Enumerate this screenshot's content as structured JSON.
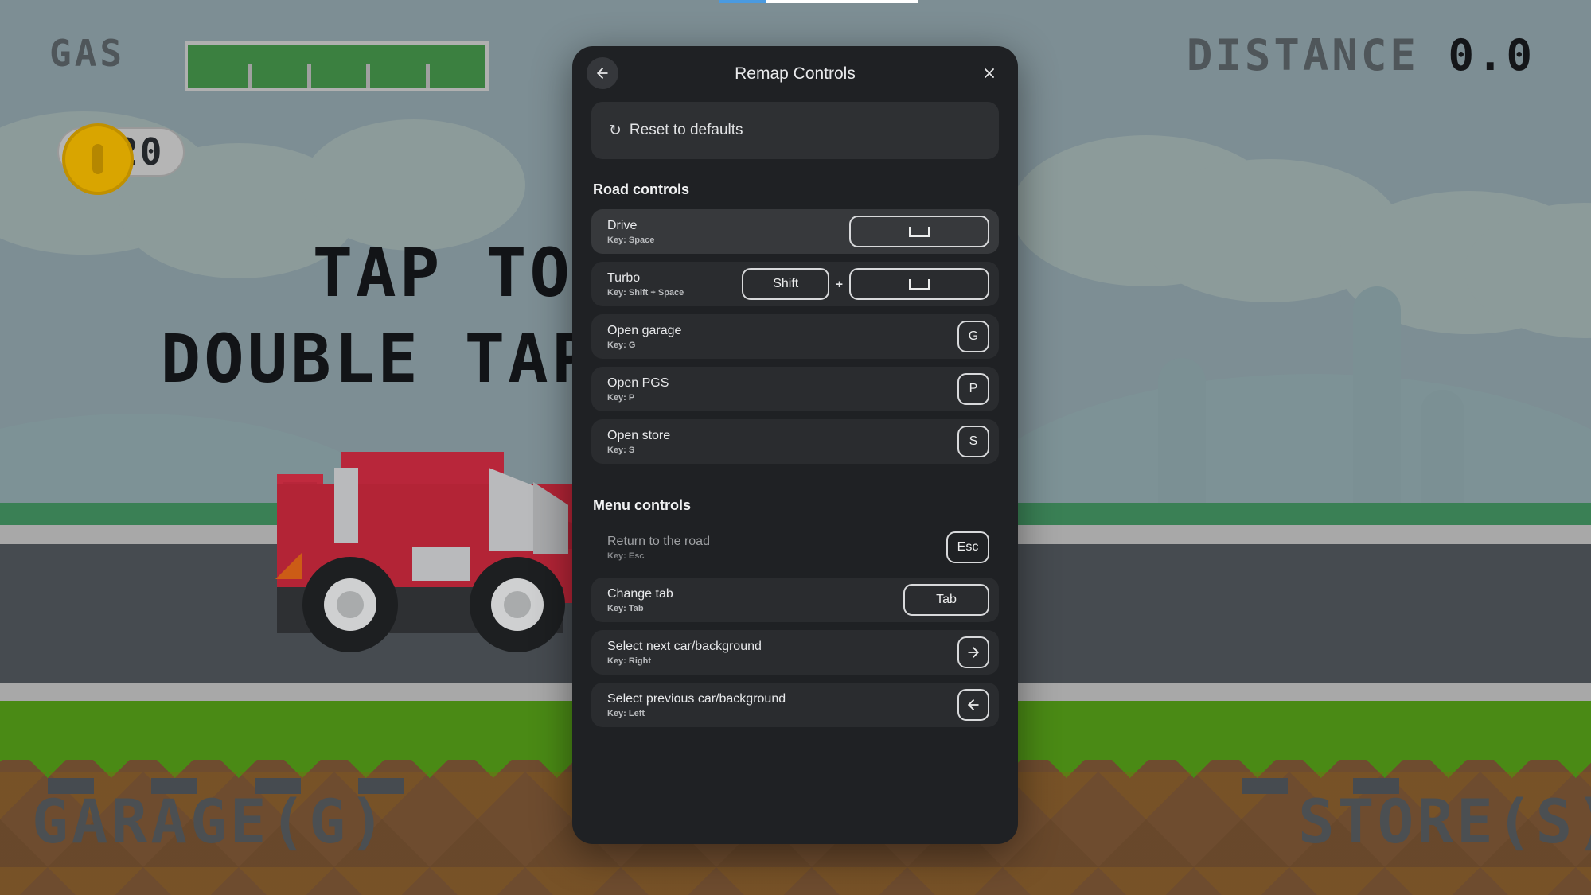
{
  "game": {
    "hud": {
      "gas_label": "GAS",
      "gas_percent": 100,
      "coins": "20",
      "distance_label": "DISTANCE",
      "distance_value": "0.0"
    },
    "center_message_line1": "TAP TO DRIVE",
    "center_message_line2": "DOUBLE TAP TO TURBO",
    "garage_label": "GARAGE(G)",
    "store_label": "STORE(S)",
    "colors": {
      "sky": "#7d8e94",
      "asphalt": "#464b50",
      "grass": "#4a8a15",
      "dirt": "#6e4c2f",
      "car_body": "#b32436",
      "gas_fill": "#3b8040",
      "coin": "#d9a500",
      "progress_accent": "#4a9ae0"
    },
    "loading_progress_percent": 24
  },
  "modal": {
    "title": "Remap Controls",
    "back_icon": "arrow-left-icon",
    "close_icon": "close-icon",
    "reset": {
      "label": "Reset to defaults",
      "icon": "refresh-icon"
    },
    "sections": [
      {
        "title": "Road controls",
        "rows": [
          {
            "name": "Drive",
            "key_text": "Key: Space",
            "highlighted": true,
            "dimmed": false,
            "keys": [
              {
                "type": "space",
                "label": "",
                "size": "wide"
              }
            ]
          },
          {
            "name": "Turbo",
            "key_text": "Key: Shift + Space",
            "highlighted": false,
            "dimmed": false,
            "separator": "+",
            "keys": [
              {
                "type": "text",
                "label": "Shift",
                "size": "med"
              },
              {
                "type": "space",
                "label": "",
                "size": "wide"
              }
            ]
          },
          {
            "name": "Open garage",
            "key_text": "Key: G",
            "highlighted": false,
            "dimmed": false,
            "keys": [
              {
                "type": "text",
                "label": "G",
                "size": "square"
              }
            ]
          },
          {
            "name": "Open PGS",
            "key_text": "Key: P",
            "highlighted": false,
            "dimmed": false,
            "keys": [
              {
                "type": "text",
                "label": "P",
                "size": "square"
              }
            ]
          },
          {
            "name": "Open store",
            "key_text": "Key: S",
            "highlighted": false,
            "dimmed": false,
            "keys": [
              {
                "type": "text",
                "label": "S",
                "size": "square"
              }
            ]
          }
        ]
      },
      {
        "title": "Menu controls",
        "rows": [
          {
            "name": "Return to the road",
            "key_text": "Key: Esc",
            "highlighted": false,
            "dimmed": true,
            "keys": [
              {
                "type": "text",
                "label": "Esc",
                "size": "esc"
              }
            ]
          },
          {
            "name": "Change tab",
            "key_text": "Key: Tab",
            "highlighted": false,
            "dimmed": false,
            "keys": [
              {
                "type": "text",
                "label": "Tab",
                "size": "tab"
              }
            ]
          },
          {
            "name": "Select next car/background",
            "key_text": "Key: Right",
            "highlighted": false,
            "dimmed": false,
            "keys": [
              {
                "type": "arrow-right",
                "label": "",
                "size": "square"
              }
            ]
          },
          {
            "name": "Select previous car/background",
            "key_text": "Key: Left",
            "highlighted": false,
            "dimmed": false,
            "keys": [
              {
                "type": "arrow-left",
                "label": "",
                "size": "square"
              }
            ]
          }
        ]
      }
    ]
  }
}
